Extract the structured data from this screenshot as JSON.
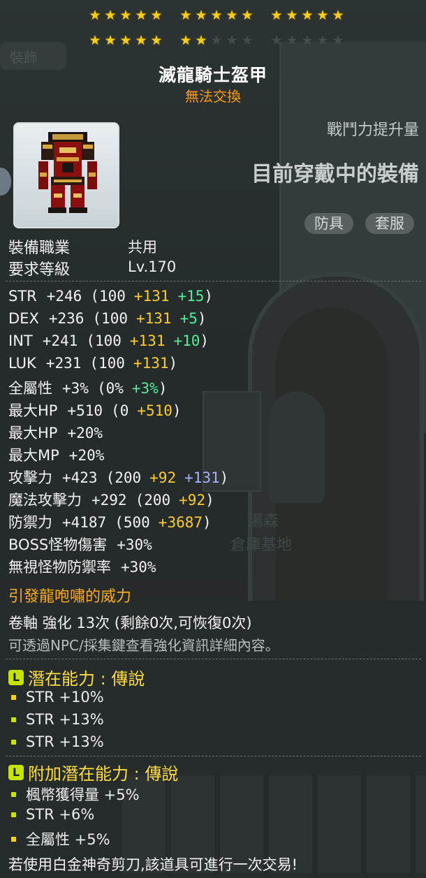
{
  "stars": {
    "groups": [
      {
        "filled": 5,
        "total": 5
      },
      {
        "filled": 5,
        "total": 5
      },
      {
        "filled": 5,
        "total": 5
      },
      {
        "filled": 5,
        "total": 5
      },
      {
        "filled": 2,
        "total": 5
      },
      {
        "filled": 0,
        "total": 5
      }
    ],
    "filled_count": 22,
    "total": 30
  },
  "item": {
    "name": "滅龍騎士盔甲",
    "trade_status": "無法交換"
  },
  "compare": {
    "label": "戰鬥力提升量",
    "status": "目前穿戴中的裝備"
  },
  "badges": [
    "防具",
    "套服"
  ],
  "requirements": [
    {
      "label": "裝備職業",
      "value": "共用"
    },
    {
      "label": "要求等級",
      "value": "Lv.170"
    }
  ],
  "stats": [
    {
      "name": "STR",
      "total": "+246",
      "base": "(100",
      "bonus": "+131",
      "enhance": "+15",
      "close": ")",
      "enhance_color": "green"
    },
    {
      "name": "DEX",
      "total": "+236",
      "base": "(100",
      "bonus": "+131",
      "enhance": "+5",
      "close": ")",
      "enhance_color": "green"
    },
    {
      "name": "INT",
      "total": "+241",
      "base": "(100",
      "bonus": "+131",
      "enhance": "+10",
      "close": ")",
      "enhance_color": "green"
    },
    {
      "name": "LUK",
      "total": "+231",
      "base": "(100",
      "bonus": "+131",
      "enhance": "",
      "close": ")",
      "enhance_color": "green"
    },
    {
      "name": "全屬性",
      "total": "+3%",
      "base": "(0%",
      "bonus": "",
      "enhance": "+3%",
      "close": ")",
      "enhance_color": "green"
    },
    {
      "name": "最大HP",
      "total": "+510",
      "base": "(0",
      "bonus": "+510",
      "enhance": "",
      "close": ")",
      "enhance_color": "green"
    },
    {
      "name": "最大HP",
      "total": "+20%",
      "base": "",
      "bonus": "",
      "enhance": "",
      "close": "",
      "enhance_color": "green"
    },
    {
      "name": "最大MP",
      "total": "+20%",
      "base": "",
      "bonus": "",
      "enhance": "",
      "close": "",
      "enhance_color": "green"
    },
    {
      "name": "攻擊力",
      "total": "+423",
      "base": "(200",
      "bonus": "+92",
      "enhance": "+131",
      "close": ")",
      "enhance_color": "purple"
    },
    {
      "name": "魔法攻擊力",
      "total": "+292",
      "base": "(200",
      "bonus": "+92",
      "enhance": "",
      "close": ")",
      "enhance_color": "green"
    },
    {
      "name": "防禦力",
      "total": "+4187",
      "base": "(500",
      "bonus": "+3687",
      "enhance": "",
      "close": ")",
      "enhance_color": "green"
    },
    {
      "name": "BOSS怪物傷害",
      "total": "+30%",
      "base": "",
      "bonus": "",
      "enhance": "",
      "close": "",
      "enhance_color": "green"
    },
    {
      "name": "無視怪物防禦率",
      "total": "+30%",
      "base": "",
      "bonus": "",
      "enhance": "",
      "close": "",
      "enhance_color": "green"
    }
  ],
  "set_effect": "引發龍咆嘯的威力",
  "scroll_info": "卷軸 強化 13次 (剩餘0次,可恢復0次)",
  "scroll_hint": "可透過NPC/採集鍵查看強化資訊詳細內容。",
  "potential": {
    "title": "潛在能力 : 傳說",
    "icon_letter": "L",
    "lines": [
      "STR +10%",
      "STR +13%",
      "STR +13%"
    ]
  },
  "additional_potential": {
    "title": "附加潛在能力 : 傳說",
    "icon_letter": "L",
    "lines": [
      "楓幣獲得量 +5%",
      "STR +6%",
      "全屬性 +5%"
    ]
  },
  "footer": "若使用白金神奇剪刀,該道具可進行一次交易!",
  "background": {
    "tab": "裝飾",
    "npc_name": "湯森",
    "npc_title": "倉庫基地"
  },
  "colors": {
    "star_on": "#f5cd1e",
    "star_off": "#454a4a",
    "trade_orange": "#ff9a1c",
    "bonus_yellow": "#ffcc33",
    "enhance_green": "#55ee99",
    "enhance_purple": "#aab0ff",
    "legend_green": "#c6e400"
  }
}
